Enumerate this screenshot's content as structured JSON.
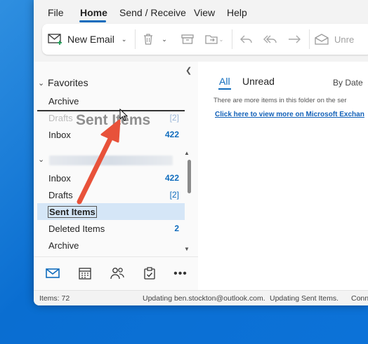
{
  "menu": {
    "file": "File",
    "home": "Home",
    "send_receive": "Send / Receive",
    "view": "View",
    "help": "Help"
  },
  "ribbon": {
    "new_email": "New Email",
    "unread_partial": "Unre"
  },
  "folders": {
    "favorites_header": "Favorites",
    "favorites": [
      {
        "label": "Archive",
        "count": ""
      },
      {
        "label": "Drafts",
        "count": "[2]"
      },
      {
        "label": "Inbox",
        "count": "422"
      }
    ],
    "account": [
      {
        "label": "Inbox",
        "count": "422"
      },
      {
        "label": "Drafts",
        "count": "[2]"
      },
      {
        "label": "Sent Items",
        "count": ""
      },
      {
        "label": "Deleted Items",
        "count": "2"
      },
      {
        "label": "Archive",
        "count": ""
      }
    ],
    "drag_ghost": "Sent Items"
  },
  "message_list": {
    "tab_all": "All",
    "tab_unread": "Unread",
    "sort": "By Date",
    "notice": "There are more items in this folder on the ser",
    "link": "Click here to view more on Microsoft Exchan"
  },
  "status": {
    "items": "Items: 72",
    "updating_account": "Updating ben.stockton@outlook.com.",
    "updating_sent": "Updating Sent Items.",
    "conn_partial": "Conn"
  },
  "colors": {
    "accent": "#0f6cbd",
    "annotation_arrow": "#e8523a",
    "desktop": "#0a6ed1"
  }
}
